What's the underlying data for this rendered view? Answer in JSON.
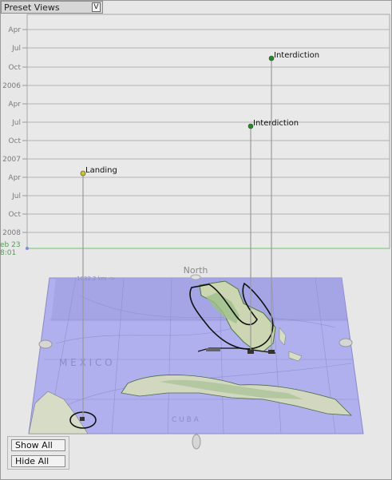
{
  "preset": {
    "label": "Preset Views",
    "dropdown_glyph": "V"
  },
  "timeline": {
    "tick_labels": [
      "Apr",
      "Jul",
      "Oct",
      "2006",
      "Apr",
      "Jul",
      "Oct",
      "2007",
      "Apr",
      "Jul",
      "Oct",
      "2008"
    ],
    "start_label_line1": "eb 23",
    "start_label_line2": "8:01"
  },
  "events": [
    {
      "label": "Landing",
      "color": "#c9c91e"
    },
    {
      "label": "Interdiction",
      "color": "#1f8f1f"
    },
    {
      "label": "Interdiction",
      "color": "#1f8f1f"
    }
  ],
  "map": {
    "north_label": "North",
    "scale_label": "1032.2 km ->",
    "gulf_label": "M E X I C O",
    "cuba_label": "C U B A"
  },
  "buttons": {
    "show_all": "Show All",
    "hide_all": "Hide All"
  },
  "colors": {
    "map_water": "#a9a8ec",
    "map_land": "#d7dcc6",
    "timeline_bg": "#e9e9e9"
  }
}
